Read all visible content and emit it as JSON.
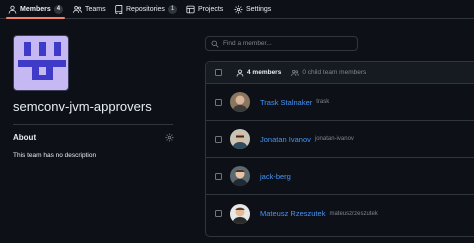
{
  "tabs": [
    {
      "label": "Members",
      "count": "4",
      "icon": "person-icon",
      "selected": true
    },
    {
      "label": "Teams",
      "icon": "people-icon"
    },
    {
      "label": "Repositories",
      "count": "1",
      "icon": "repo-icon"
    },
    {
      "label": "Projects",
      "icon": "table-icon"
    },
    {
      "label": "Settings",
      "icon": "gear-icon"
    }
  ],
  "team": {
    "name": "semconv-jvm-approvers",
    "about_heading": "About",
    "description": "This team has no description"
  },
  "search": {
    "placeholder": "Find a member..."
  },
  "members_header": {
    "members_label": "4 members",
    "child_label": "0 child team members"
  },
  "members": [
    {
      "name": "Trask Stalnaker",
      "login": "trask"
    },
    {
      "name": "Jonatan Ivanov",
      "login": "jonatan-ivanov"
    },
    {
      "name": "jack-berg",
      "login": ""
    },
    {
      "name": "Mateusz Rzeszutek",
      "login": "mateuszrzeszutek"
    }
  ],
  "colors": {
    "background": "#0d1117",
    "border": "#30363d",
    "link": "#4493f8",
    "muted": "#7d8590",
    "selected_tab_underline": "#f78166",
    "team_avatar": "#c6b8f2",
    "team_avatar_glyph": "#3f3bc8"
  }
}
